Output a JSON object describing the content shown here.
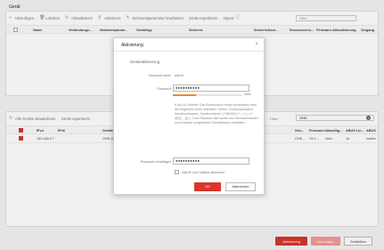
{
  "tabs": [
    {
      "label": "Gerät"
    }
  ],
  "top_toolbar": {
    "items": [
      "Hinzufügen",
      "Löschen",
      "Aktualisieren",
      "Aktivieren",
      "Netzwerkparameter bearbeiten",
      "Gerät exportieren",
      "Import"
    ],
    "search_label": "Filter",
    "search_placeholder": "Filter"
  },
  "top_table": {
    "columns": [
      "Name",
      "Verbindungs...",
      "Netzwerkparam...",
      "Gerätetyp",
      "Seriennr.",
      "Sicherheitsst...",
      "Ressourcenn...",
      "Firmware-Aktualisierung",
      "Vorgang"
    ]
  },
  "bottom_toolbar": {
    "items": [
      "Alle Geräte aktualisieren",
      "Gerät exportieren"
    ],
    "search_label": "Filter",
    "search_value": "ONE"
  },
  "bottom_table": {
    "columns": [
      "IPv4",
      "IPv6",
      "Gerätetyp",
      "Ges...",
      "Firmware-...",
      "Hinzufüg...",
      "ABUS Lin...",
      "ABUS"
    ],
    "rows": [
      {
        "ipv4": "192.168.0.7",
        "ipv6": "",
        "type": "ONE-D...",
        "ges": "ONE...",
        "fw": "V5.1...",
        "added": "Nein",
        "link": "Ja",
        "abus": "Inaktiv"
      }
    ]
  },
  "footer": {
    "activate": "Aktivierung",
    "add": "Hinzufügen",
    "close": "Schließen"
  },
  "modal": {
    "title": "Aktivierung",
    "close_icon": "close-icon",
    "section": "Geräteaktivierung",
    "username_label": "Benutzername",
    "username_value": "admin",
    "password_label": "Passwort",
    "password_value": "●●●●●●●●●●",
    "strength_label": "Stark",
    "hint": "8 bis 16 Zeichen: Die Kombination muss mindestens zwei der folgenden Arten enthalten: Ziffern, Großbuchstaben, Kleinbuchstaben, Sonderzeichen (!\"#$%&'()*+,-./:;<=>?@[\\]^_`{|}~). Das Passwort darf weder den Benutzernamen noch dessen umgekehrte Schreibweise enthalten.",
    "confirm_label": "Passwort bestätigen",
    "confirm_value": "●●●●●●●●●●",
    "checkbox_label": "ABUS Link Station aktivieren",
    "ok": "OK",
    "cancel": "Abbrechen"
  },
  "colors": {
    "accent": "#d8352f",
    "accent_disabled": "#f19a95"
  }
}
